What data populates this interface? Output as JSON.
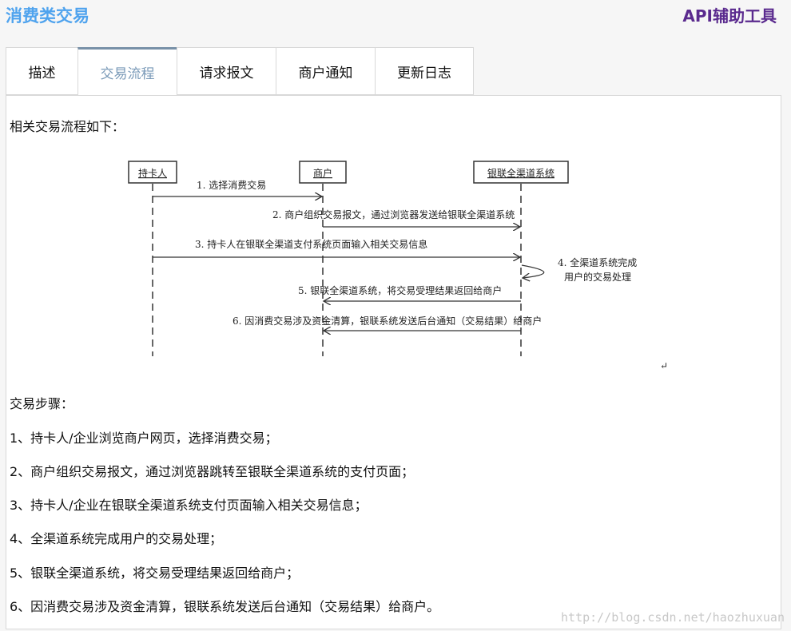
{
  "header": {
    "title": "消费类交易",
    "tool_link": "API辅助工具"
  },
  "tabs": [
    {
      "label": "描述"
    },
    {
      "label": "交易流程"
    },
    {
      "label": "请求报文"
    },
    {
      "label": "商户通知"
    },
    {
      "label": "更新日志"
    }
  ],
  "content": {
    "intro": "相关交易流程如下：",
    "diagram": {
      "actors": [
        "持卡人",
        "商户",
        "银联全渠道系统"
      ],
      "messages": [
        "1. 选择消费交易",
        "2. 商户组织交易报文，通过浏览器发送给银联全渠道系统",
        "3. 持卡人在银联全渠道支付系统页面输入相关交易信息",
        "4. 全渠道系统完成",
        "用户的交易处理",
        "5. 银联全渠道系统，将交易受理结果返回给商户",
        "6. 因消费交易涉及资金清算，银联系统发送后台通知（交易结果）给商户"
      ],
      "return_mark": "↵"
    },
    "steps_title": "交易步骤：",
    "steps": [
      "1、持卡人/企业浏览商户网页，选择消费交易；",
      "2、商户组织交易报文，通过浏览器跳转至银联全渠道系统的支付页面；",
      "3、持卡人/企业在银联全渠道系统支付页面输入相关交易信息；",
      "4、全渠道系统完成用户的交易处理；",
      "5、银联全渠道系统，将交易受理结果返回给商户；",
      "6、因消费交易涉及资金清算，银联系统发送后台通知（交易结果）给商户。"
    ]
  },
  "watermark": "http://blog.csdn.net/haozhuxuan"
}
